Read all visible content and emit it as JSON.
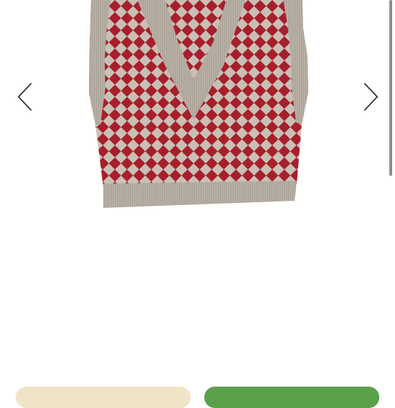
{
  "gallery": {
    "image": {
      "subject": "sweater-vest-argyle"
    },
    "prev_icon": "chevron-left-icon",
    "next_icon": "chevron-right-icon"
  },
  "colors": {
    "vest_red": "#a71f2a",
    "vest_gray": "#c9bfb5",
    "rib_gray": "#b5aca2",
    "arrow": "#333333",
    "button_secondary": "#f0e4c8",
    "button_primary": "#5aa04b"
  },
  "bottom_bar": {
    "secondary_label": "",
    "primary_label": ""
  }
}
